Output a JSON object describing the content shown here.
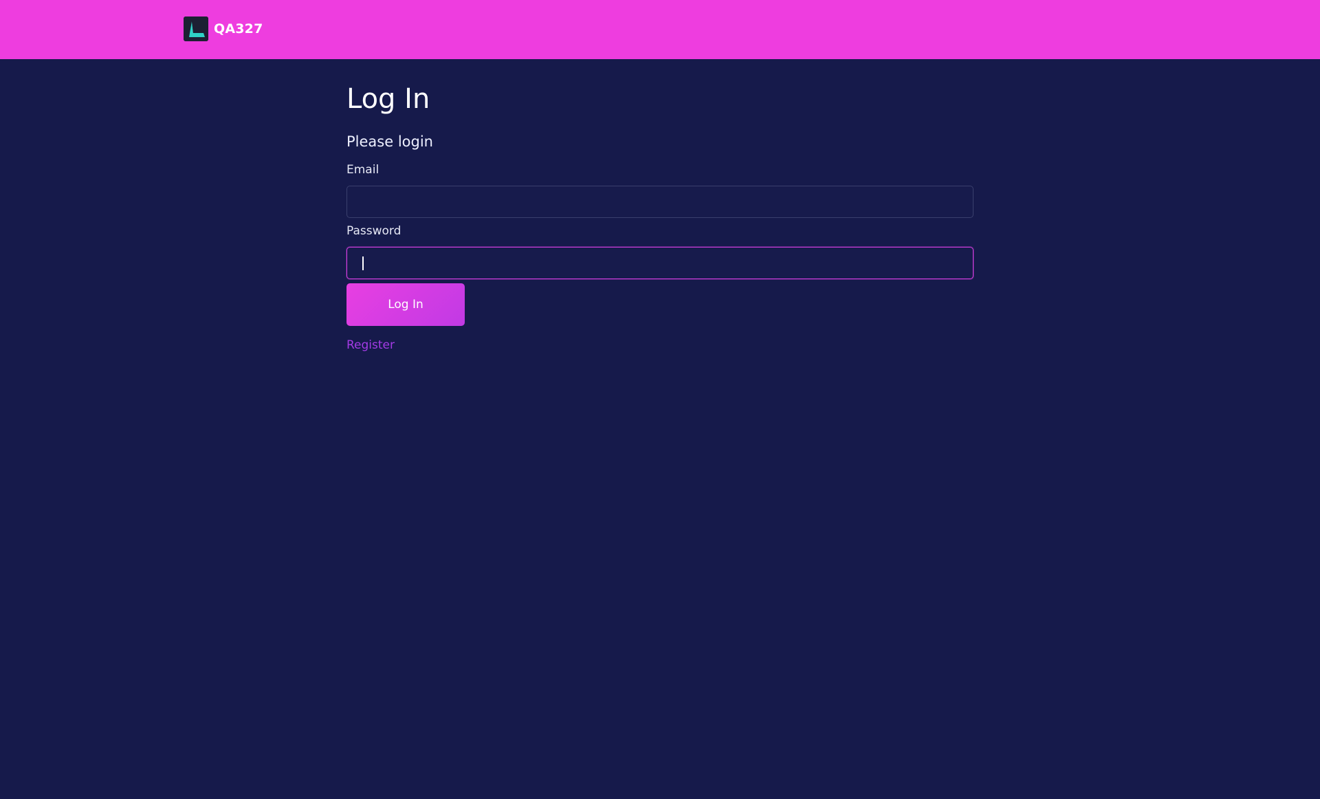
{
  "header": {
    "brand_name": "QA327",
    "logo_icon": "triangle-logo-icon",
    "background_color": "#ee3ddf"
  },
  "login": {
    "title": "Log In",
    "subtitle": "Please login",
    "email_label": "Email",
    "email_value": "",
    "password_label": "Password",
    "password_value": "",
    "submit_label": "Log In",
    "register_label": "Register"
  },
  "colors": {
    "page_background": "#161a4b",
    "accent": "#e83fe2",
    "link": "#a43be6"
  }
}
